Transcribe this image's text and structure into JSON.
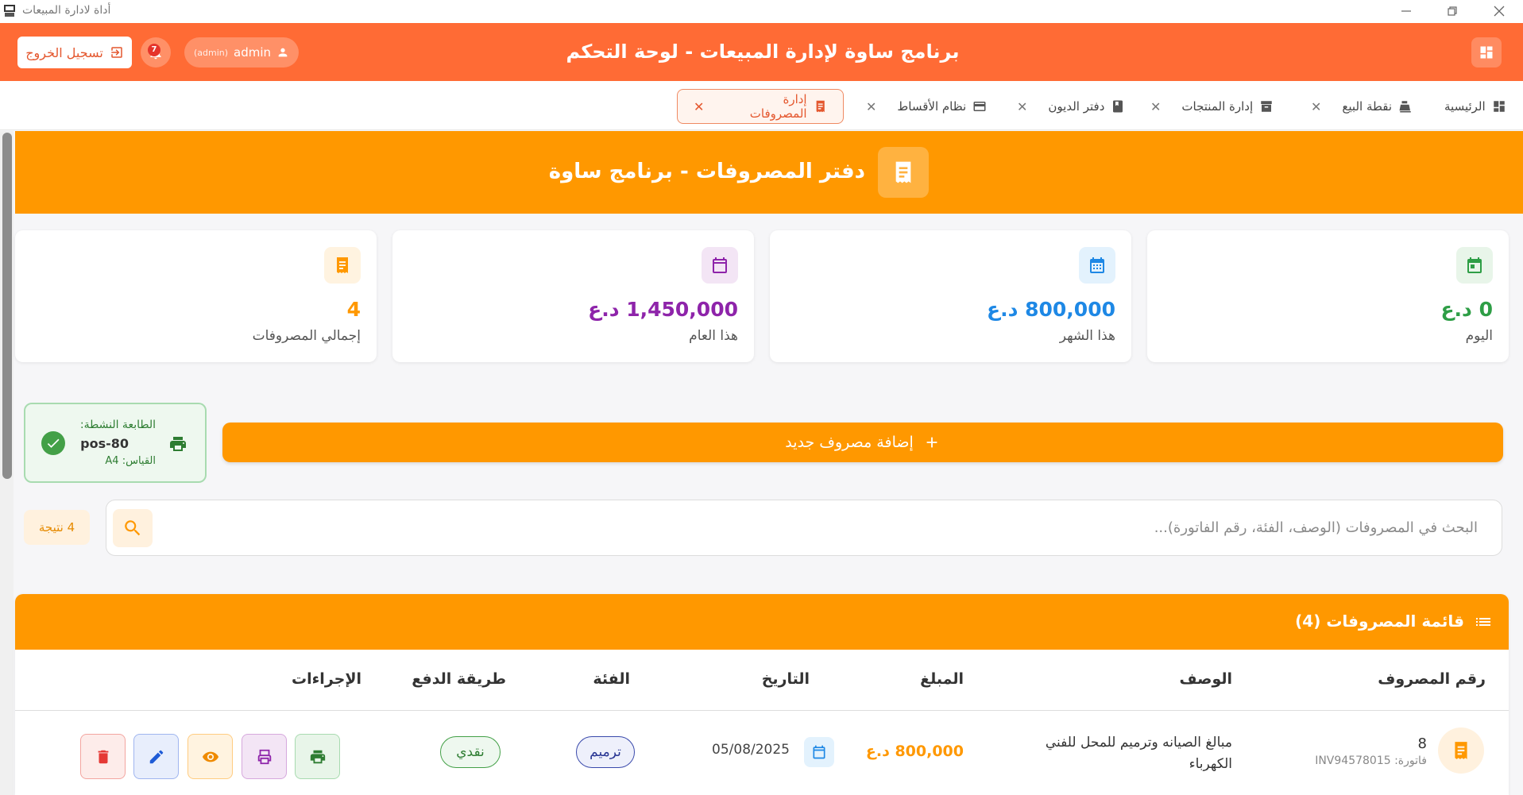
{
  "window": {
    "title": "أداة لادارة المبيعات"
  },
  "header": {
    "title": "برنامج ساوة لإدارة المبيعات - لوحة التحكم",
    "logout_label": "تسجيل الخروج",
    "user_name": "admin",
    "user_role": "(admin)",
    "notification_count": "7"
  },
  "tabs": [
    {
      "label": "الرئيسية",
      "icon": "dashboard-icon"
    },
    {
      "label": "نقطة البيع",
      "icon": "cash-register-icon"
    },
    {
      "label": "إدارة المنتجات",
      "icon": "archive-icon"
    },
    {
      "label": "دفتر الديون",
      "icon": "book-icon"
    },
    {
      "label": "نظام الأقساط",
      "icon": "credit-card-icon"
    },
    {
      "label": "إدارة المصروفات",
      "icon": "receipt-icon",
      "active": true
    }
  ],
  "banner": {
    "title": "دفتر المصروفات - برنامج ساوة"
  },
  "stats": [
    {
      "label": "اليوم",
      "value": "0 د.ع",
      "color": "#2e9e46",
      "bg": "#e8f5e9",
      "icon": "calendar-today-icon"
    },
    {
      "label": "هذا الشهر",
      "value": "800,000 د.ع",
      "color": "#1e88e5",
      "bg": "#e3f2fd",
      "icon": "calendar-month-icon"
    },
    {
      "label": "هذا العام",
      "value": "1,450,000 د.ع",
      "color": "#8e24aa",
      "bg": "#f3e5f5",
      "icon": "calendar-year-icon"
    },
    {
      "label": "إجمالي المصروفات",
      "value": "4",
      "color": "#ff9800",
      "bg": "#fff3e0",
      "icon": "receipt-icon"
    }
  ],
  "printer": {
    "label": "الطابعة النشطة:",
    "name": "pos-80",
    "size_label": "القياس: A4"
  },
  "add_button_label": "إضافة مصروف جديد",
  "search": {
    "placeholder": "البحث في المصروفات (الوصف، الفئة، رقم الفاتورة)...",
    "value": "",
    "result_count": "4 نتيجة"
  },
  "table": {
    "title": "قائمة المصروفات (4)",
    "columns": [
      "رقم المصروف",
      "الوصف",
      "المبلغ",
      "التاريخ",
      "الفئة",
      "طريقة الدفع",
      "الإجراءات"
    ],
    "rows": [
      {
        "id": "8",
        "invoice": "فاتورة: INV94578015",
        "description": "مبالغ الصيانه وترميم للمحل للفني الكهرباء",
        "amount": "800,000 د.ع",
        "date": "05/08/2025",
        "category": "ترميم",
        "payment": "نقدي"
      }
    ]
  },
  "colors": {
    "header": "#ff6b35",
    "banner": "#ff9800",
    "accent": "#e4572e"
  }
}
